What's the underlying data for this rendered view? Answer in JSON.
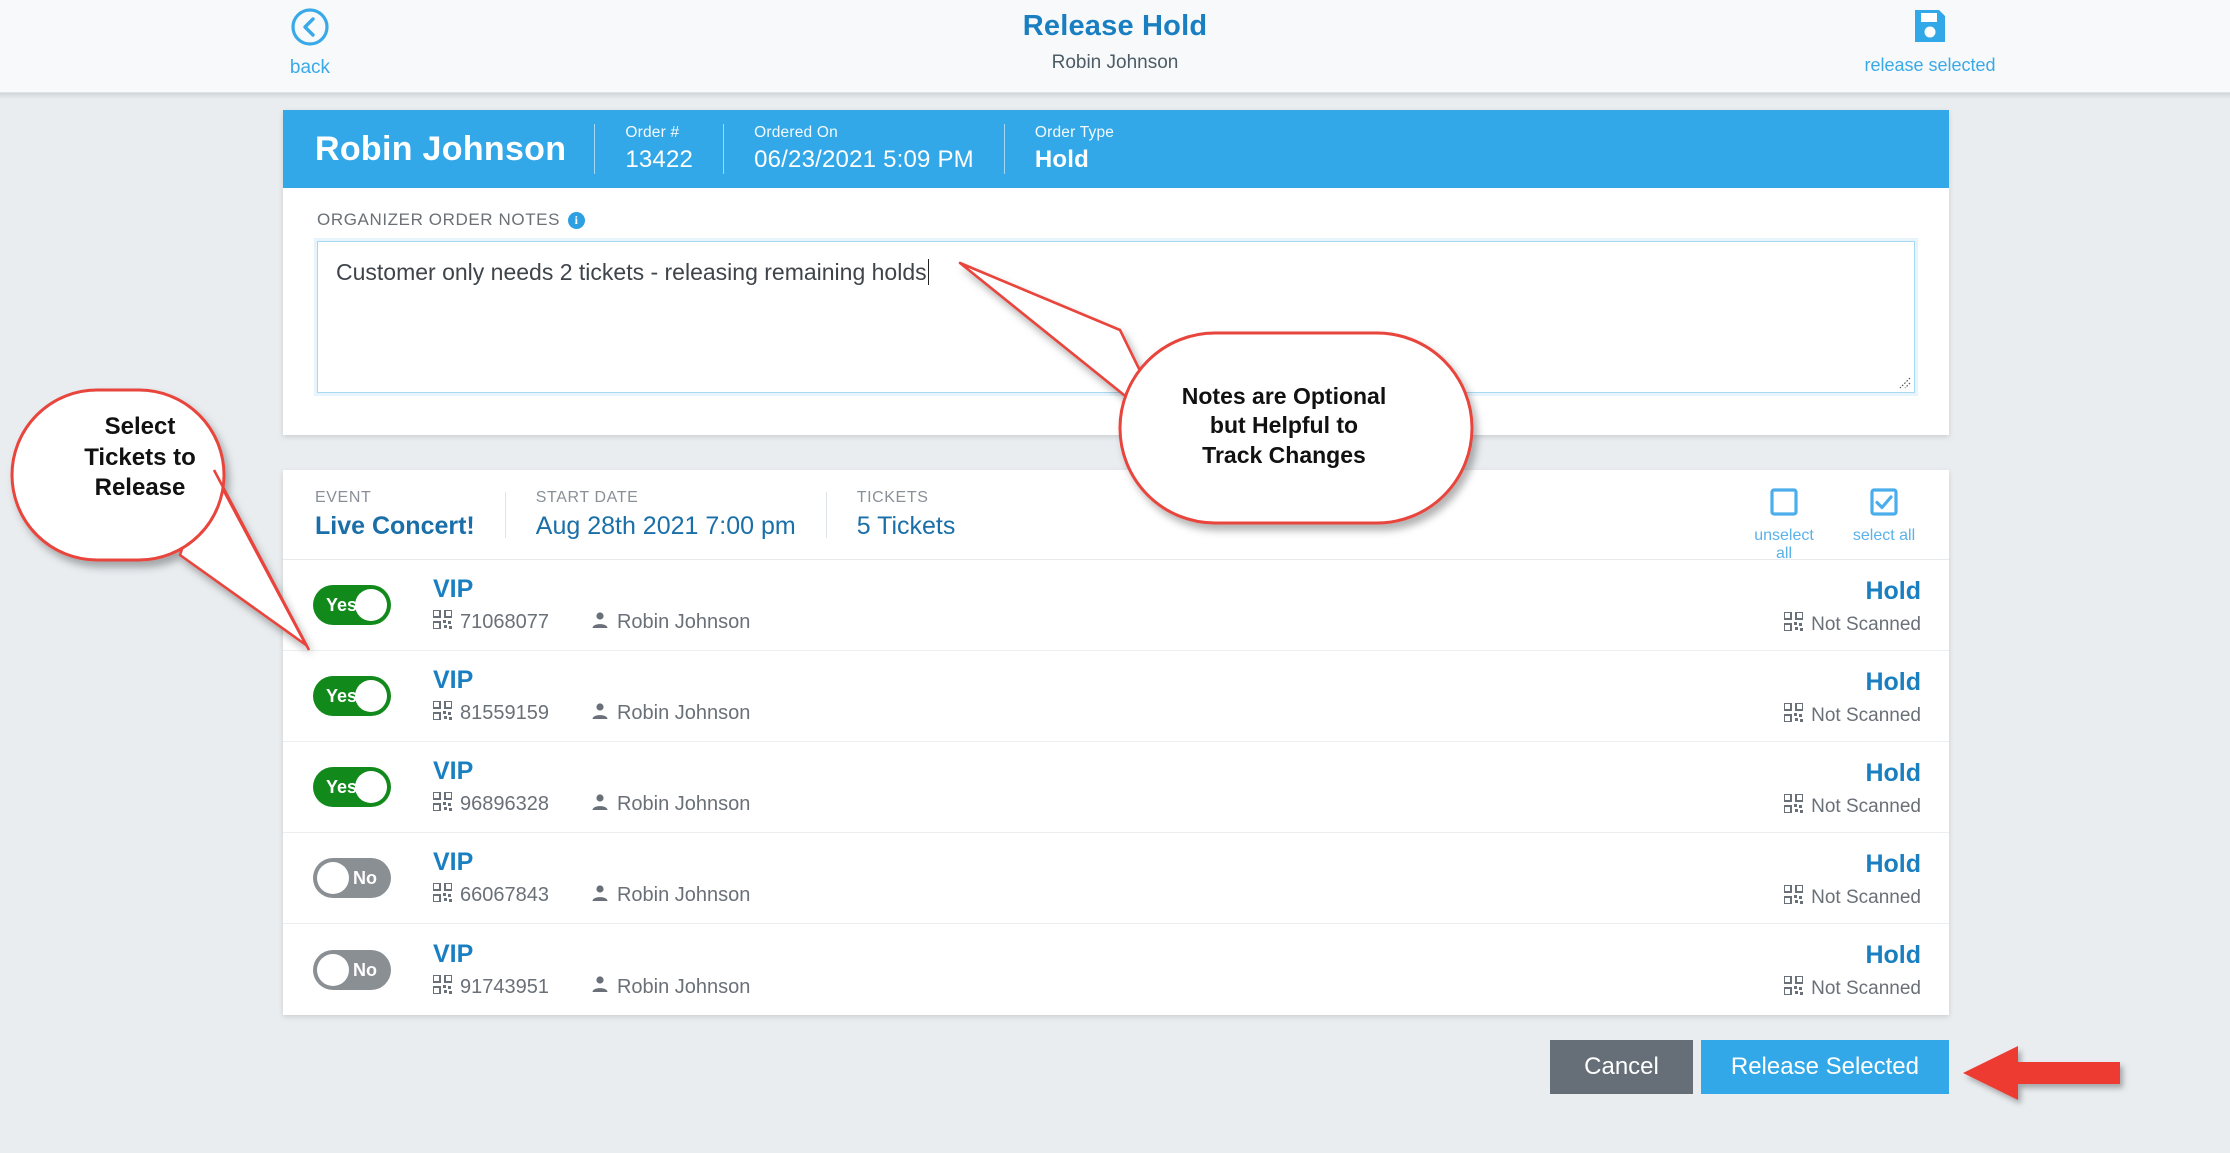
{
  "topbar": {
    "back_label": "back",
    "back_icon": "chevron-left-circle-icon",
    "title": "Release Hold",
    "subtitle": "Robin Johnson",
    "save_label": "release selected",
    "save_icon": "save-floppy-icon"
  },
  "order": {
    "customer_name": "Robin Johnson",
    "fields": [
      {
        "label": "Order #",
        "value": "13422",
        "bold": false
      },
      {
        "label": "Ordered On",
        "value": "06/23/2021 5:09 PM",
        "bold": false
      },
      {
        "label": "Order Type",
        "value": "Hold",
        "bold": true
      }
    ],
    "notes_label": "ORGANIZER ORDER NOTES",
    "notes_info_icon": "info-icon",
    "notes_value": "Customer only needs 2 tickets - releasing remaining holds",
    "notes_placeholder": ""
  },
  "tickets_header": {
    "fields": [
      {
        "label": "EVENT",
        "value": "Live Concert!",
        "bold": true
      },
      {
        "label": "START DATE",
        "value": "Aug 28th 2021 7:00 pm",
        "bold": false
      },
      {
        "label": "TICKETS",
        "value": "5 Tickets",
        "bold": false
      }
    ],
    "unselect_all_label": "unselect all",
    "unselect_all_icon": "empty-checkbox-icon",
    "select_all_label": "select all",
    "select_all_icon": "checked-checkbox-icon"
  },
  "tickets": [
    {
      "selected": true,
      "toggle_label": "Yes",
      "type": "VIP",
      "barcode": "71068077",
      "attendee": "Robin Johnson",
      "status": "Hold",
      "scan_status": "Not Scanned"
    },
    {
      "selected": true,
      "toggle_label": "Yes",
      "type": "VIP",
      "barcode": "81559159",
      "attendee": "Robin Johnson",
      "status": "Hold",
      "scan_status": "Not Scanned"
    },
    {
      "selected": true,
      "toggle_label": "Yes",
      "type": "VIP",
      "barcode": "96896328",
      "attendee": "Robin Johnson",
      "status": "Hold",
      "scan_status": "Not Scanned"
    },
    {
      "selected": false,
      "toggle_label": "No",
      "type": "VIP",
      "barcode": "66067843",
      "attendee": "Robin Johnson",
      "status": "Hold",
      "scan_status": "Not Scanned"
    },
    {
      "selected": false,
      "toggle_label": "No",
      "type": "VIP",
      "barcode": "91743951",
      "attendee": "Robin Johnson",
      "status": "Hold",
      "scan_status": "Not Scanned"
    }
  ],
  "footer": {
    "cancel_label": "Cancel",
    "release_label": "Release Selected"
  },
  "annotations": {
    "left_line1": "Select",
    "left_line2": "Tickets to",
    "left_line3": "Release",
    "right_line1": "Notes are Optional",
    "right_line2": "but Helpful to",
    "right_line3": "Track Changes",
    "arrow_color": "#ee3b33",
    "callout_border_color": "#e8443d"
  },
  "colors": {
    "brand_blue": "#32a8e8",
    "link_blue": "#1a7fc1",
    "toggle_on_green": "#118a1b",
    "toggle_off_gray": "#8a8f94",
    "cancel_gray": "#666f77",
    "page_bg": "#e9edf0"
  }
}
